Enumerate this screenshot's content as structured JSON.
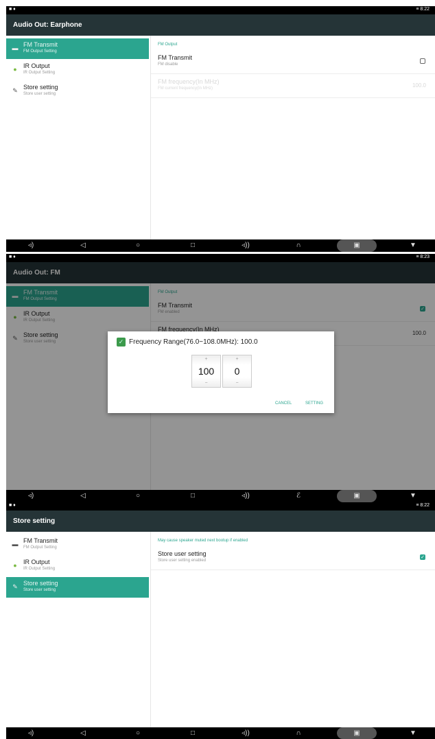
{
  "status": {
    "left_icons": "■ ♦",
    "time": "8:22",
    "time2": "8:23",
    "signal": "≡"
  },
  "panel1": {
    "title": "Audio Out: Earphone",
    "sidebar": [
      {
        "title": "FM Transmit",
        "subtitle": "FM Output Setting",
        "icon": "fm-icon"
      },
      {
        "title": "IR Output",
        "subtitle": "IR Output Setting",
        "icon": "ir-icon"
      },
      {
        "title": "Store setting",
        "subtitle": "Store user setting",
        "icon": "store-icon"
      }
    ],
    "category": "FM Output",
    "fm_transmit": {
      "title": "FM Transmit",
      "summary": "FM disable",
      "checked": false
    },
    "fm_frequency": {
      "title": "FM frequency(In MHz)",
      "summary": "FM current frequency(In MHz)",
      "value": "100.0"
    }
  },
  "panel2": {
    "title": "Audio Out: FM",
    "category": "FM Output",
    "fm_transmit": {
      "title": "FM Transmit",
      "summary": "FM enabled",
      "checked": true
    },
    "fm_frequency_value": "100.0",
    "dialog": {
      "title": "Frequency Range(76.0~108.0MHz): 100.0",
      "picker_int": "100",
      "picker_dec": "0",
      "plus": "+",
      "minus": "−",
      "cancel": "CANCEL",
      "setting": "SETTING"
    }
  },
  "panel3": {
    "title": "Store setting",
    "category": "May cause speaker muted next bootup if enabled",
    "store": {
      "title": "Store user setting",
      "summary": "Store user setting enabled",
      "checked": true
    }
  },
  "nav": {
    "vol_down": "◃)",
    "back": "◁",
    "home": "○",
    "recents": "□",
    "vol_up": "◃))",
    "headphone": "∩",
    "fm": "ℰ",
    "camera": "▣",
    "menu": "▼"
  },
  "colors": {
    "accent": "#2ba58f",
    "titlebar": "#253437"
  }
}
